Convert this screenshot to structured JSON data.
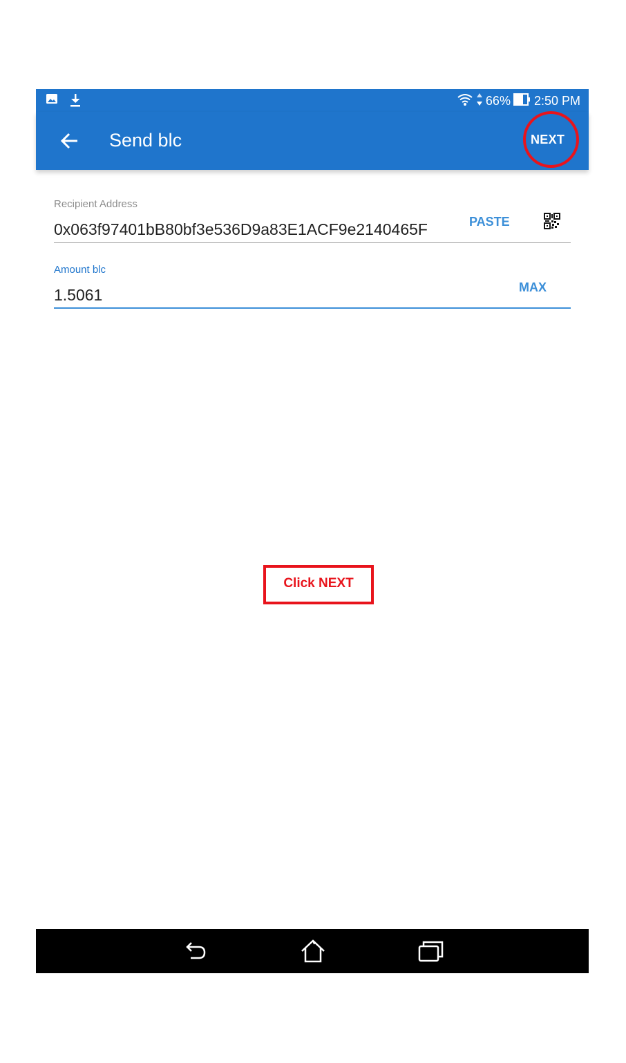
{
  "status_bar": {
    "battery": "66%",
    "time": "2:50 PM",
    "left_icons": [
      "image-icon",
      "download-icon"
    ],
    "right_icons": [
      "wifi-icon",
      "data-arrows-icon",
      "battery-icon"
    ]
  },
  "app_bar": {
    "back_icon": "arrow-left-icon",
    "title": "Send blc",
    "next_label": "NEXT"
  },
  "form": {
    "recipient": {
      "label": "Recipient Address",
      "value": "0x063f97401bB80bf3e536D9a83E1ACF9e2140465F",
      "paste_label": "PASTE",
      "qr_icon": "qr-code-icon"
    },
    "amount": {
      "label": "Amount blc",
      "value": "1.5061",
      "max_label": "MAX"
    }
  },
  "annotation": {
    "text": "Click NEXT"
  },
  "nav_bar": {
    "icons": [
      "back-nav-icon",
      "home-nav-icon",
      "recents-nav-icon"
    ]
  },
  "colors": {
    "primary": "#1f75cc",
    "accent": "#3c8fd8",
    "annotation_red": "#e8141c"
  }
}
